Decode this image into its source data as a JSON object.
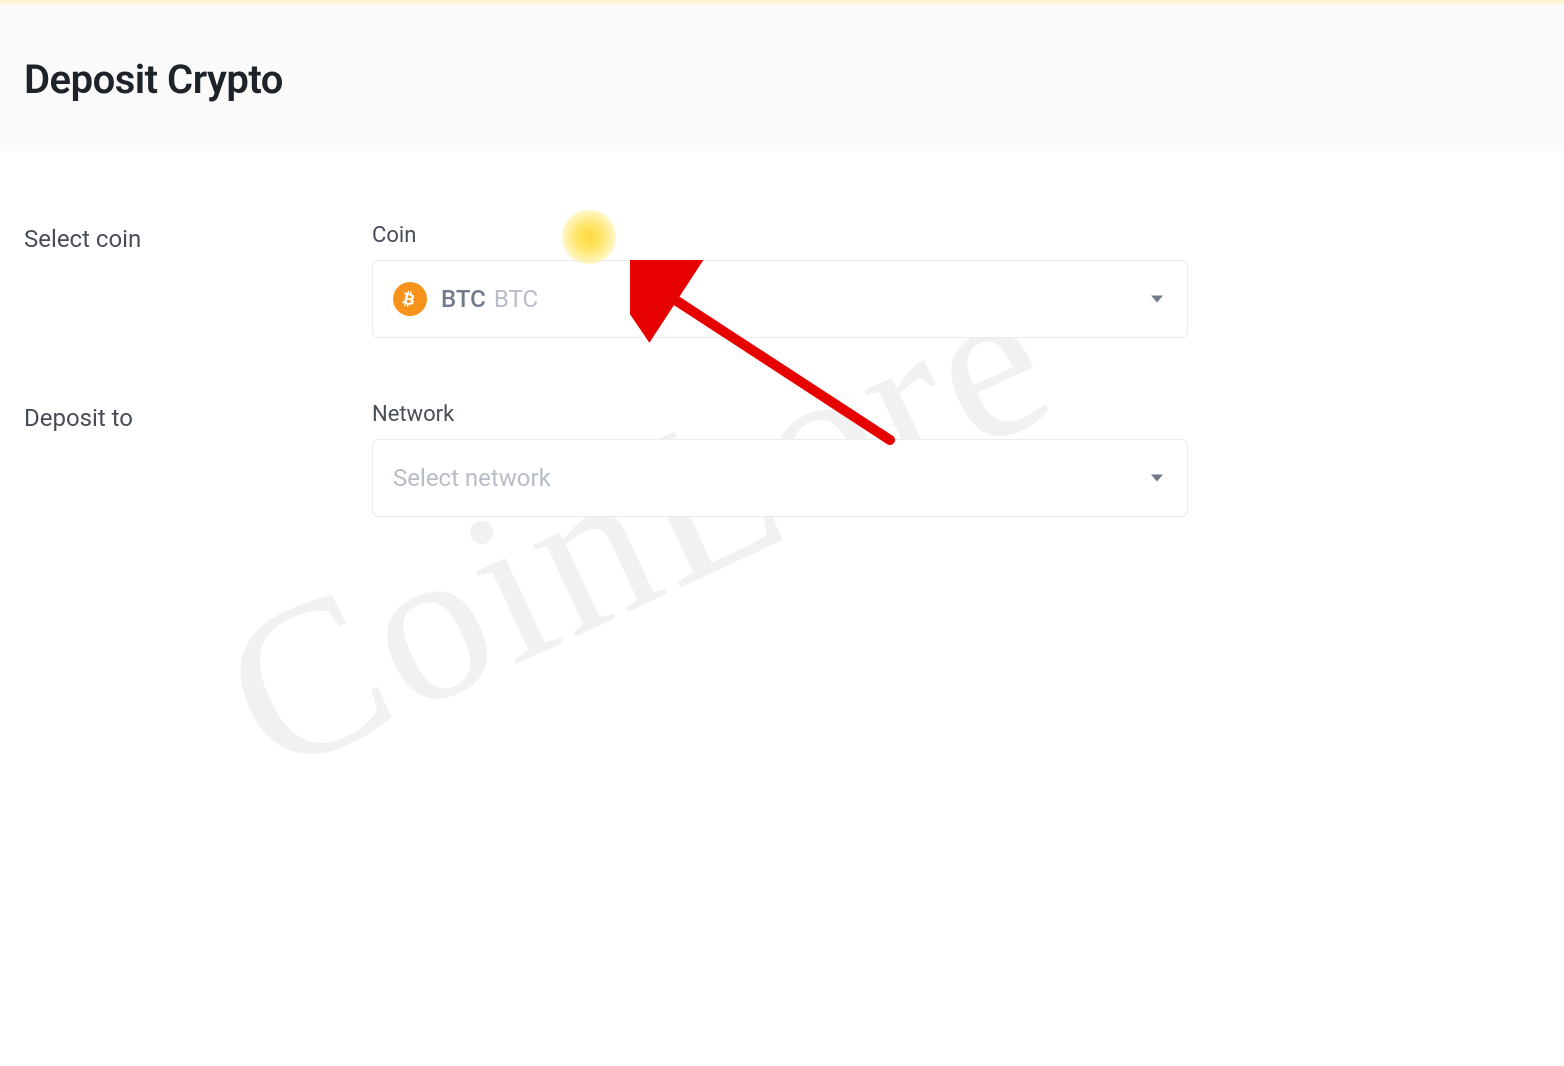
{
  "header": {
    "title": "Deposit Crypto"
  },
  "form": {
    "coin_section": {
      "row_label": "Select coin",
      "field_label": "Coin",
      "selected_ticker": "BTC",
      "selected_name": "BTC"
    },
    "network_section": {
      "row_label": "Deposit to",
      "field_label": "Network",
      "placeholder": "Select network"
    }
  },
  "watermark": {
    "text": "CoinLore"
  },
  "icons": {
    "bitcoin": "bitcoin-icon",
    "caret": "chevron-down-icon"
  },
  "colors": {
    "bitcoin_orange": "#f7931a",
    "highlight_yellow": "#ffd93d",
    "arrow_red": "#e60000"
  }
}
